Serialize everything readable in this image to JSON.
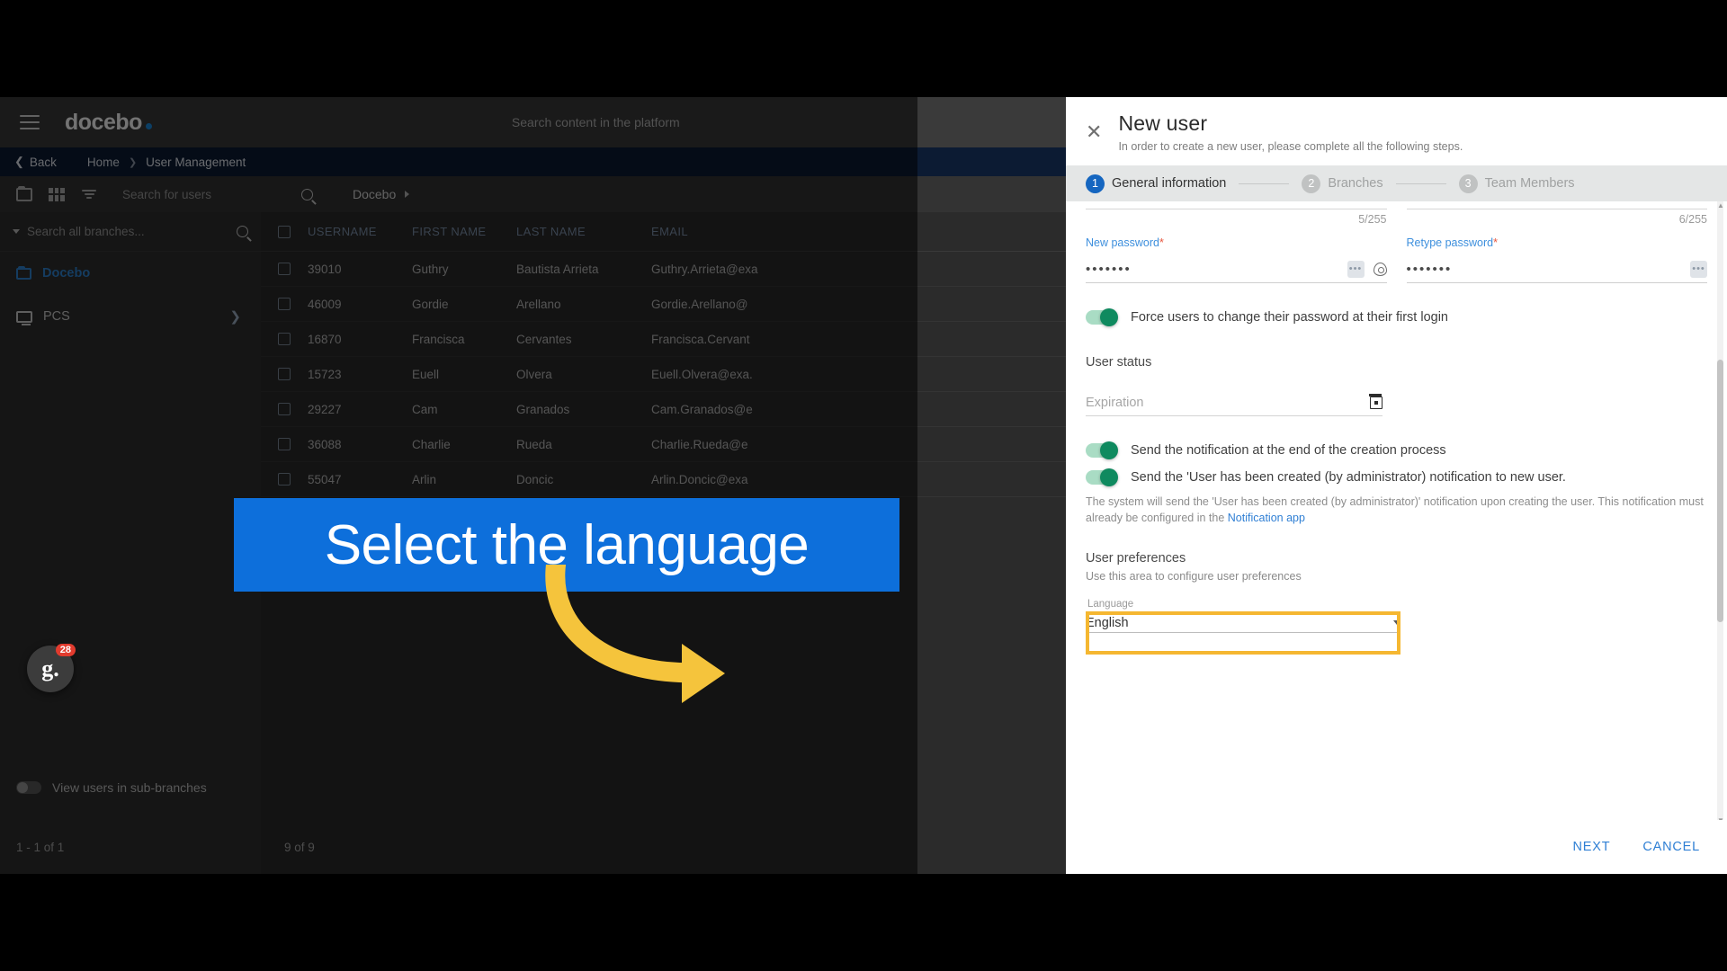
{
  "app": {
    "brand": "docebo",
    "global_search_placeholder": "Search content in the platform",
    "breadcrumb": {
      "back": "Back",
      "home": "Home",
      "current": "User Management"
    },
    "toolbar": {
      "search_placeholder": "Search for users",
      "org_label": "Docebo"
    },
    "tree": {
      "search_placeholder": "Search all branches...",
      "items": [
        {
          "label": "Docebo",
          "icon": "folder-icon",
          "selected": true
        },
        {
          "label": "PCS",
          "icon": "computer-icon",
          "selected": false
        }
      ],
      "sub_branch_toggle_label": "View users in sub-branches",
      "pagination": "1 - 1 of 1"
    },
    "table": {
      "columns": [
        "USERNAME",
        "FIRST NAME",
        "LAST NAME",
        "EMAIL"
      ],
      "rows": [
        {
          "username": "39010",
          "first": "Guthry",
          "last": "Bautista Arrieta",
          "email": "Guthry.Arrieta@exa"
        },
        {
          "username": "46009",
          "first": "Gordie",
          "last": "Arellano",
          "email": "Gordie.Arellano@"
        },
        {
          "username": "16870",
          "first": "Francisca",
          "last": "Cervantes",
          "email": "Francisca.Cervant"
        },
        {
          "username": "15723",
          "first": "Euell",
          "last": "Olvera",
          "email": "Euell.Olvera@exa."
        },
        {
          "username": "29227",
          "first": "Cam",
          "last": "Granados",
          "email": "Cam.Granados@e"
        },
        {
          "username": "36088",
          "first": "Charlie",
          "last": "Rueda",
          "email": "Charlie.Rueda@e"
        },
        {
          "username": "55047",
          "first": "Arlin",
          "last": "Doncic",
          "email": "Arlin.Doncic@exa"
        }
      ],
      "count_label": "9 of 9"
    }
  },
  "modal": {
    "title": "New user",
    "subtitle": "In order to create a new user, please complete all the following steps.",
    "close_icon": "close-icon",
    "steps": [
      {
        "num": "1",
        "label": "General information",
        "state": "active"
      },
      {
        "num": "2",
        "label": "Branches",
        "state": "idle"
      },
      {
        "num": "3",
        "label": "Team Members",
        "state": "idle"
      }
    ],
    "counters": {
      "left": "5/255",
      "right": "6/255"
    },
    "new_password": {
      "label": "New password",
      "required_marker": "*",
      "value": "•••••••",
      "generate_icon": "generate-password-icon",
      "reveal_icon": "eye-icon"
    },
    "retype_password": {
      "label": "Retype password",
      "required_marker": "*",
      "value": "•••••••",
      "generate_icon": "generate-password-icon"
    },
    "force_change": {
      "label": "Force users to change their password at their first login",
      "enabled": true
    },
    "user_status": {
      "title": "User status",
      "expiration_placeholder": "Expiration",
      "calendar_icon": "calendar-icon"
    },
    "notifications": {
      "line1": "Send the notification at the end of the creation process",
      "line2": "Send the 'User has been created (by administrator) notification to new user.",
      "help": "The system will send the 'User has been created (by administrator)' notification upon creating the user. This notification must already be configured in the",
      "help_link": "Notification app"
    },
    "user_preferences": {
      "title": "User preferences",
      "subtitle": "Use this area to configure user preferences"
    },
    "language": {
      "field_label": "Language",
      "value": "English",
      "caret_icon": "chevron-down-icon"
    },
    "footer": {
      "next": "NEXT",
      "cancel": "CANCEL"
    }
  },
  "overlay": {
    "callout_text": "Select the language",
    "callout_color": "#0d6fdb",
    "arrow_color": "#f5c43c",
    "highlight_color": "#f5b731"
  },
  "badge": {
    "letter": "g.",
    "count": "28"
  }
}
